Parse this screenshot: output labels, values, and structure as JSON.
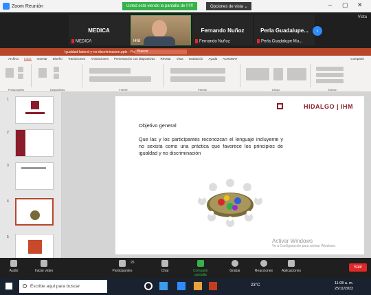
{
  "zoom": {
    "title": "Zoom Reunión",
    "share_banner": "Usted está viendo la pantalla de !!!!!!",
    "view_options": "Opciones de vista ⌄",
    "side_view": "Vista"
  },
  "participants": [
    {
      "name": "MEDICA",
      "sub": "MEDICA"
    },
    {
      "name": "HNI",
      "sub": ""
    },
    {
      "name": "Fernando Nuñoz",
      "sub": "Fernando Nuñoz"
    },
    {
      "name": "Perla Guadalupe...",
      "sub": "Perla Guadalupe Mu..."
    }
  ],
  "ppt": {
    "filename": "Igualdad-laboral-y-no-discriminacion.pptx - PowerPoint",
    "search": "Buscar",
    "tabs": [
      "Archivo",
      "Inicio",
      "Insertar",
      "Diseño",
      "Transiciones",
      "Animaciones",
      "Presentación con diapositivas",
      "Revisar",
      "Vista",
      "Grabación",
      "Ayuda",
      "ACROBAT"
    ],
    "share": "Compartir",
    "ribbon_groups": [
      "Portapapeles",
      "Diapositivas",
      "Fuente",
      "Párrafo",
      "Dibujo",
      "Edición"
    ],
    "slide_numbers": [
      "1",
      "2",
      "3",
      "4",
      "5"
    ]
  },
  "slide": {
    "logo_text": "HIDALGO | IHM",
    "heading": "Objetivo general",
    "body": "Que las y los participantes reconozcan el lenguaje incluyente y no sexista como una práctica que favorece los principios de igualdad y no discriminación"
  },
  "watermark": {
    "title": "Activar Windows",
    "subtitle": "Ve a Configuración para activar Windows."
  },
  "controls": [
    "Audio",
    "Iniciar video",
    "Participantes",
    "Chat",
    "Compartir pantalla",
    "Grabar",
    "Reacciones",
    "Aplicaciones"
  ],
  "participant_count": "26",
  "leave_label": "Salir",
  "taskbar": {
    "search_placeholder": "Escribe aquí para buscar",
    "weather": "23°C",
    "time": "11:08 a. m.",
    "date": "25/11/2022"
  }
}
